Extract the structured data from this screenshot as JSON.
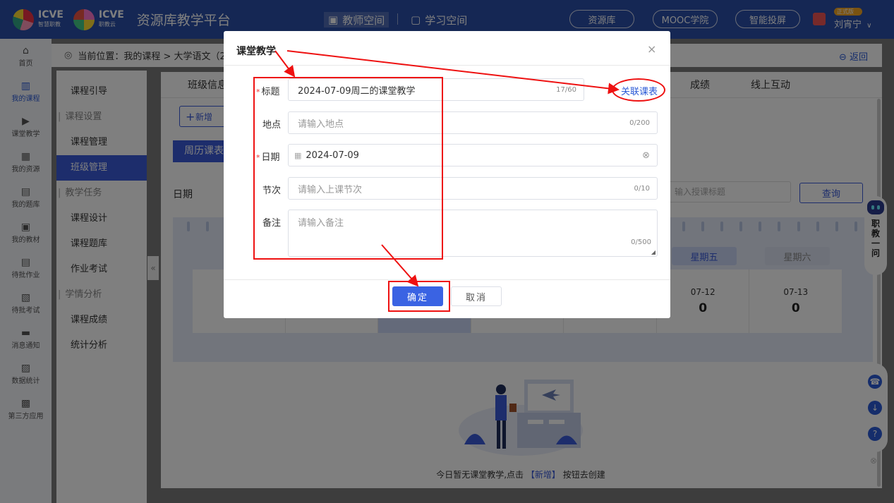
{
  "header": {
    "brand1": "ICVE",
    "brand1_sub": "智慧职教",
    "brand2": "ICVE",
    "brand2_sub": "职教云",
    "platform_title": "资源库教学平台",
    "space_active": "教师空间",
    "space_inactive": "学习空间",
    "pills": [
      "资源库",
      "MOOC学院",
      "智能投屏"
    ],
    "badge": "正式版",
    "user_name": "刘宵宁",
    "user_caret": "∨"
  },
  "leftnav": [
    {
      "icon": "home-icon",
      "glyph": "⌂",
      "label": "首页"
    },
    {
      "icon": "book-icon",
      "glyph": "▥",
      "label": "我的课程"
    },
    {
      "icon": "play-icon",
      "glyph": "▶",
      "label": "课堂教学"
    },
    {
      "icon": "resource-icon",
      "glyph": "▦",
      "label": "我的资源"
    },
    {
      "icon": "question-bank-icon",
      "glyph": "▤",
      "label": "我的题库"
    },
    {
      "icon": "textbook-icon",
      "glyph": "▣",
      "label": "我的教材"
    },
    {
      "icon": "homework-icon",
      "glyph": "▤",
      "label": "待批作业"
    },
    {
      "icon": "exam-icon",
      "glyph": "▧",
      "label": "待批考试"
    },
    {
      "icon": "message-icon",
      "glyph": "▬",
      "label": "消息通知"
    },
    {
      "icon": "stats-icon",
      "glyph": "▨",
      "label": "数据统计"
    },
    {
      "icon": "apps-icon",
      "glyph": "▩",
      "label": "第三方应用"
    }
  ],
  "submenu": {
    "guide": "课程引导",
    "group_settings": "课程设置",
    "course_mgmt": "课程管理",
    "class_mgmt": "班级管理",
    "group_tasks": "教学任务",
    "course_design": "课程设计",
    "course_bank": "课程题库",
    "homework": "作业考试",
    "group_analysis": "学情分析",
    "course_grades": "课程成绩",
    "stats": "统计分析"
  },
  "breadcrumb": {
    "text": "当前位置：我的课程 > 大学语文（2F",
    "back": "返回"
  },
  "main": {
    "tabs": [
      "班级信息",
      "成绩",
      "线上互动"
    ],
    "add_label": "新增",
    "cal_tab": "周历课表",
    "date_label": "日期",
    "search_placeholder": "输入授课标题",
    "search_button": "查询",
    "weekdays": [
      "星期五",
      "星期六"
    ],
    "days": [
      {
        "date": "07-12",
        "count": "0"
      },
      {
        "date": "07-13",
        "count": "0"
      }
    ],
    "empty_prefix": "今日暂无课堂教学,点击",
    "empty_link": "【新增】",
    "empty_suffix": "按钮去创建"
  },
  "assistant": [
    "职",
    "教",
    "一",
    "问"
  ],
  "modal": {
    "title": "课堂教学",
    "close": "×",
    "title_label": "标题",
    "title_value": "2024-07-09周二的课堂教学",
    "title_count": "17/60",
    "link_schedule": "关联课表",
    "location_label": "地点",
    "location_placeholder": "请输入地点",
    "location_count": "0/200",
    "date_label": "日期",
    "date_value": "2024-07-09",
    "period_label": "节次",
    "period_placeholder": "请输入上课节次",
    "period_count": "0/10",
    "remark_label": "备注",
    "remark_placeholder": "请输入备注",
    "remark_count": "0/500",
    "ok": "确定",
    "cancel": "取消"
  },
  "colors": {
    "header_bg": "#2b4ea8",
    "primary": "#3a5bd9",
    "annotation": "#e11111"
  }
}
